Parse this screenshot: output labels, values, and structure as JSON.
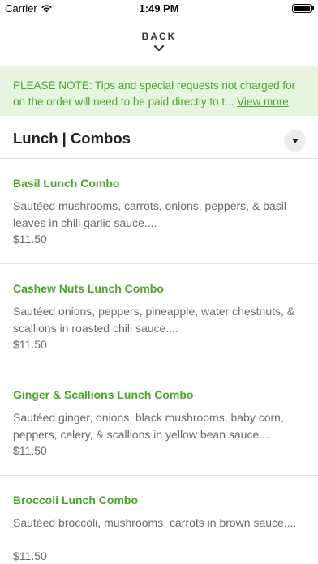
{
  "status_bar": {
    "carrier": "Carrier",
    "time": "1:49 PM"
  },
  "nav": {
    "back_label": "BACK"
  },
  "notice": {
    "text_line1": "PLEASE NOTE: Tips and special requests not charged for",
    "text_line2": "on the order will need to be paid directly to t...",
    "link_label": "View more"
  },
  "section": {
    "title": "Lunch | Combos"
  },
  "items": [
    {
      "name": "Basil Lunch Combo",
      "desc_line1": "Sautéed mushrooms, carrots, onions, peppers, & basil",
      "desc_line2": "leaves in chili garlic sauce....",
      "price": "$11.50"
    },
    {
      "name": "Cashew Nuts Lunch Combo",
      "desc_line1": "Sautéed onions, peppers, pineapple, water chestnuts, &",
      "desc_line2": "scallions in roasted chili sauce....",
      "price": "$11.50"
    },
    {
      "name": "Ginger & Scallions Lunch Combo",
      "desc_line1": "Sautéed ginger, onions, black mushrooms, baby corn,",
      "desc_line2": "peppers, celery, & scallions in yellow bean sauce....",
      "price": "$11.50"
    },
    {
      "name": "Broccoli Lunch Combo",
      "desc_line1": "Sautéed broccoli, mushrooms, carrots in brown sauce....",
      "desc_line2": "",
      "price": "$11.50"
    }
  ],
  "colors": {
    "accent_green": "#4aa52b",
    "notice_bg": "#e5f5df",
    "muted_text": "#6b6b6b"
  },
  "icons": [
    "wifi-icon",
    "battery-icon",
    "chevron-down-icon",
    "dropdown-triangle-icon"
  ]
}
